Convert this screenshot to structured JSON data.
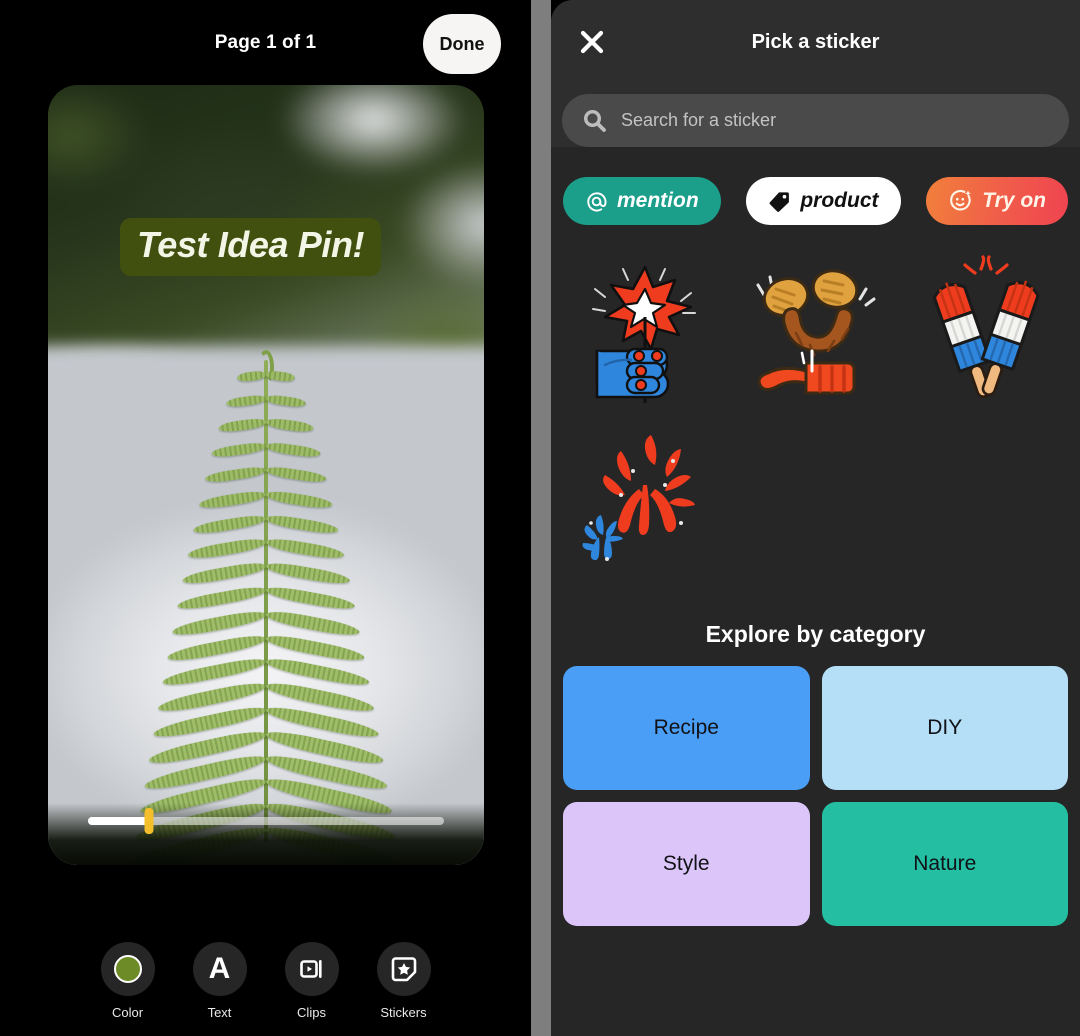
{
  "editor": {
    "page_indicator": "Page 1 of 1",
    "done_label": "Done",
    "canvas": {
      "text_sticker": "Test Idea Pin!",
      "text_sticker_bg_color": "#42500f",
      "text_sticker_color": "#f3f6e6",
      "scrubber_position_percent": 17,
      "scrubber_handle_color": "#f4bf2a"
    },
    "toolbar": [
      {
        "label": "Color",
        "icon": "color-swatch-icon",
        "swatch_color": "#6d8b27"
      },
      {
        "label": "Text",
        "icon": "text-a-icon"
      },
      {
        "label": "Clips",
        "icon": "clips-icon"
      },
      {
        "label": "Stickers",
        "icon": "sticker-star-icon"
      }
    ]
  },
  "sticker_panel": {
    "title": "Pick a sticker",
    "close_icon": "close-icon",
    "search": {
      "placeholder": "Search for a sticker",
      "value": "",
      "icon": "search-icon"
    },
    "chips": [
      {
        "label": "mention",
        "icon": "at-sign-icon",
        "bg": "#1b9e8a",
        "fg": "#ffffff"
      },
      {
        "label": "product",
        "icon": "price-tag-icon",
        "bg": "#ffffff",
        "fg": "#111111"
      },
      {
        "label": "Try on",
        "icon": "smiley-sparkle-icon",
        "bg": "#f1803b",
        "fg": "#fff4e8"
      }
    ],
    "stickers": [
      {
        "name": "sparkler-hand-sticker"
      },
      {
        "name": "bbq-grill-sticker"
      },
      {
        "name": "popsicles-sticker"
      },
      {
        "name": "fireworks-sticker"
      }
    ],
    "explore_title": "Explore by category",
    "categories": [
      {
        "label": "Recipe",
        "color": "#4a9ef5"
      },
      {
        "label": "DIY",
        "color": "#b4dff7"
      },
      {
        "label": "Style",
        "color": "#dcc6f9"
      },
      {
        "label": "Nature",
        "color": "#24bfa2"
      }
    ]
  }
}
